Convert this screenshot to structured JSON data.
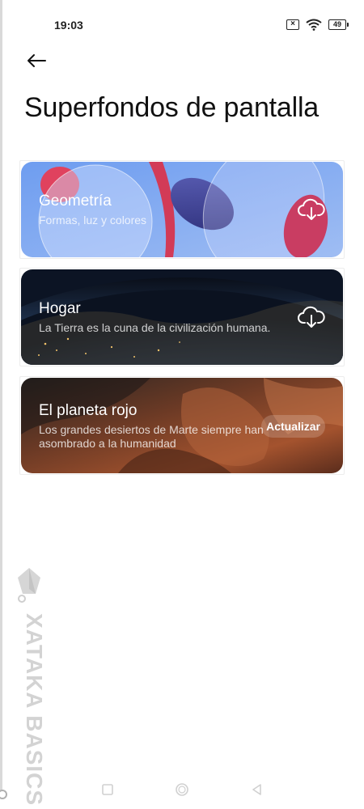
{
  "status_bar": {
    "time": "19:03",
    "sim_icon": "sim-off-icon",
    "wifi_icon": "wifi-icon",
    "battery_level": "49"
  },
  "header": {
    "back_icon": "arrow-left-icon",
    "title": "Superfondos de pantalla"
  },
  "cards": [
    {
      "title": "Geometría",
      "subtitle": "Formas, luz y colores",
      "action_icon": "cloud-download-icon"
    },
    {
      "title": "Hogar",
      "subtitle": "La Tierra es la cuna de la civilización humana.",
      "action_icon": "cloud-download-icon"
    },
    {
      "title": "El planeta rojo",
      "subtitle": "Los grandes desiertos de Marte siempre han asombrado a la humanidad",
      "action_label": "Actualizar"
    }
  ],
  "watermark": {
    "text": "XATAKA BASICS",
    "logo_icon": "xataka-logo-icon"
  },
  "nav_bar": {
    "recents_icon": "square-icon",
    "home_icon": "circle-icon",
    "back_icon": "triangle-back-icon"
  },
  "colors": {
    "geometria_bg": "#7fa7ee",
    "hogar_bg": "#1d2c44",
    "planeta_bg": "#7a3d22"
  }
}
